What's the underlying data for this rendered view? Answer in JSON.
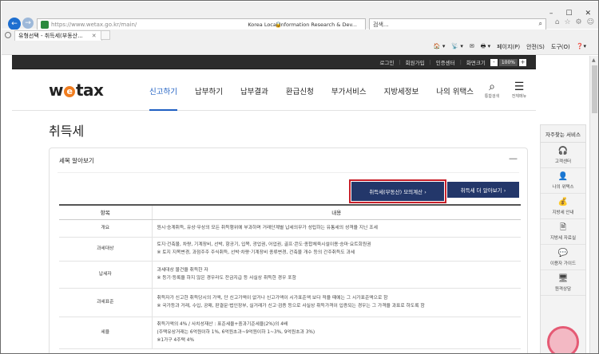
{
  "browser": {
    "url": "https://www.wetax.go.kr/main/",
    "site_name": "Korea Local Information Research & Dev...",
    "search_placeholder": "검색...",
    "tab_title": "취득세(부동산)...",
    "fav_label": "유형선택 - 취득세(부동산...",
    "command_items": [
      "페이지(P)",
      "안전(S)",
      "도구(O)"
    ]
  },
  "util": {
    "items": [
      "로그인",
      "회원가입",
      "인증센터",
      "화면크기"
    ],
    "zoom_minus": "-",
    "zoom_value": "100%",
    "zoom_plus": "+"
  },
  "header": {
    "logo_pre": "w",
    "logo_e": "e",
    "logo_post": "tax",
    "menu": [
      "신고하기",
      "납부하기",
      "납부결과",
      "환급신청",
      "부가서비스",
      "지방세정보",
      "나의 위택스"
    ],
    "search_label": "통합검색",
    "all_menu_label": "전체메뉴"
  },
  "page": {
    "title": "취득세"
  },
  "card": {
    "heading": "세목 알아보기",
    "btn_calc": "취득세(부동산) 모의계산  ›",
    "btn_more": "취득세 더 알아보기  ›",
    "col_item": "항목",
    "col_content": "내용",
    "rows": [
      {
        "k": "개요",
        "v": "원시·승계취득, 유상·무상의 모든 취득행위에 부과하며 거래단계별 납세의무가 성립하는 유통세의 성격을 지닌 조세"
      },
      {
        "k": "과세대상",
        "v": "토지·건축물, 차량, 기계장비, 선박, 항공기, 입목, 광업권, 어업권, 골프·콘도·종합체육시설이용·승마·요트회원권\n※ 토지 지목변경, 과점주주 주식취득, 선박·차량·기계장비 종류변경, 건축물 개수 등의 간주취득도 과세"
      },
      {
        "k": "납세자",
        "v": "과세대상 물건을 취득한 자\n※ 등기·등록을 하지 않은 경우라도 잔금지급 등 사실상 취득한 경우 포함"
      },
      {
        "k": "과세표준",
        "v": "취득자가 신고한 취득당시의 가액, 단 신고가액이 없거나 신고가액이 시가표준액 보다 적을 때에는 그 시가표준액으로 함\n※ 국가등과 거래, 수입, 공매, 판결문·법인장부, 실거래가 신고·검증 등으로 사실상 취득가격이 입증되는 경우는 그 가격을 과표로 하도록 함"
      },
      {
        "k": "세율",
        "v": "취득가액의 4% / 사치성재산 : 표준세율+중과기준세율(2%)의 4배\n(주택유상거래는 6억원이하 1%, 6억원초과~9억원이하 1~3%, 9억원초과 3%)\n※1가구 4주택 4%"
      }
    ]
  },
  "quick": {
    "title": "자주찾는 서비스",
    "items": [
      "고객센터",
      "나의 위택스",
      "지방세 안내",
      "지방세 자료실",
      "이용자 가이드",
      "원격상담"
    ]
  }
}
